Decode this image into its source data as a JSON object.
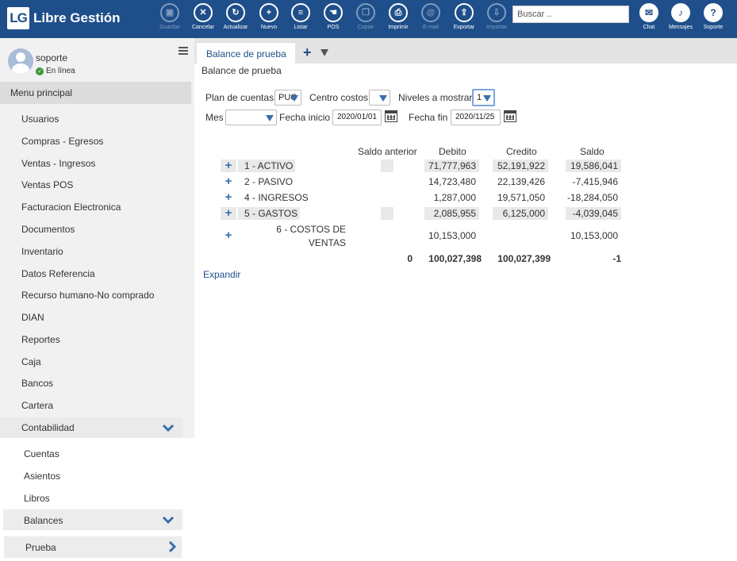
{
  "app": {
    "logo_mark": "LG",
    "logo_text": "Libre Gestión"
  },
  "toolbar": [
    {
      "label": "Guardar",
      "icon": "save-icon",
      "glyph": "▣",
      "disabled": true
    },
    {
      "label": "Cancelar",
      "icon": "cancel-icon",
      "glyph": "✕",
      "disabled": false
    },
    {
      "label": "Actualizar",
      "icon": "refresh-icon",
      "glyph": "↻",
      "disabled": false
    },
    {
      "label": "Nuevo",
      "icon": "plus-icon",
      "glyph": "+",
      "disabled": false
    },
    {
      "label": "Listar",
      "icon": "list-icon",
      "glyph": "≡",
      "disabled": false
    },
    {
      "label": "POS",
      "icon": "hand-icon",
      "glyph": "☚",
      "disabled": false
    },
    {
      "label": "Copiar",
      "icon": "copy-icon",
      "glyph": "❐",
      "disabled": true
    },
    {
      "label": "Imprimir",
      "icon": "print-icon",
      "glyph": "⎙",
      "disabled": false
    },
    {
      "label": "E-mail",
      "icon": "email-icon",
      "glyph": "@",
      "disabled": true
    },
    {
      "label": "Exportar",
      "icon": "export-icon",
      "glyph": "⇪",
      "disabled": false
    },
    {
      "label": "Importar",
      "icon": "import-icon",
      "glyph": "⇩",
      "disabled": true
    }
  ],
  "search": {
    "placeholder": "Buscar .."
  },
  "right_tools": [
    {
      "label": "Chat",
      "icon": "chat-icon",
      "glyph": "✉"
    },
    {
      "label": "Mensajes",
      "icon": "bell-icon",
      "glyph": "♪"
    },
    {
      "label": "Soporte",
      "icon": "help-icon",
      "glyph": "?"
    }
  ],
  "user": {
    "name": "soporte",
    "status": "En línea"
  },
  "sidebar": {
    "menu_title": "Menu principal",
    "items": [
      "Usuarios",
      "Compras - Egresos",
      "Ventas - Ingresos",
      "Ventas POS",
      "Facturacion Electronica",
      "Documentos",
      "Inventario",
      "Datos Referencia",
      "Recurso humano-No comprado",
      "DIAN",
      "Reportes",
      "Caja",
      "Bancos",
      "Cartera",
      "Contabilidad"
    ],
    "contabilidad_sub": [
      "Cuentas",
      "Asientos",
      "Libros",
      "Balances"
    ],
    "balances_sub": [
      "Prueba"
    ]
  },
  "tabs": [
    {
      "label": "Balance de prueba"
    }
  ],
  "page": {
    "breadcrumb": "Balance de prueba",
    "filters": {
      "plan_label": "Plan de cuentas",
      "plan_value": "PUC",
      "centro_label": "Centro costos",
      "centro_value": "",
      "niveles_label": "Niveles a mostrar",
      "niveles_value": "1",
      "mes_label": "Mes",
      "mes_value": "",
      "fecha_inicio_label": "Fecha inicio",
      "fecha_inicio": "2020/01/01",
      "fecha_fin_label": "Fecha fin",
      "fecha_fin": "2020/11/25"
    },
    "table": {
      "headers": [
        "Saldo anterior",
        "Debito",
        "Credito",
        "Saldo"
      ],
      "rows": [
        {
          "account": "1 - ACTIVO",
          "saldo_anterior": "",
          "debito": "71,777,963",
          "credito": "52,191,922",
          "saldo": "19,586,041"
        },
        {
          "account": "2 - PASIVO",
          "saldo_anterior": "",
          "debito": "14,723,480",
          "credito": "22,139,426",
          "saldo": "-7,415,946"
        },
        {
          "account": "4 - INGRESOS",
          "saldo_anterior": "",
          "debito": "1,287,000",
          "credito": "19,571,050",
          "saldo": "-18,284,050"
        },
        {
          "account": "5 - GASTOS",
          "saldo_anterior": "",
          "debito": "2,085,955",
          "credito": "6,125,000",
          "saldo": "-4,039,045"
        },
        {
          "account_line1": "6 - COSTOS DE",
          "account_line2": "VENTAS",
          "saldo_anterior": "",
          "debito": "10,153,000",
          "credito": "",
          "saldo": "10,153,000"
        }
      ],
      "totals": {
        "saldo_anterior": "0",
        "debito": "100,027,398",
        "credito": "100,027,399",
        "saldo": "-1"
      }
    },
    "expand_link": "Expandir"
  }
}
